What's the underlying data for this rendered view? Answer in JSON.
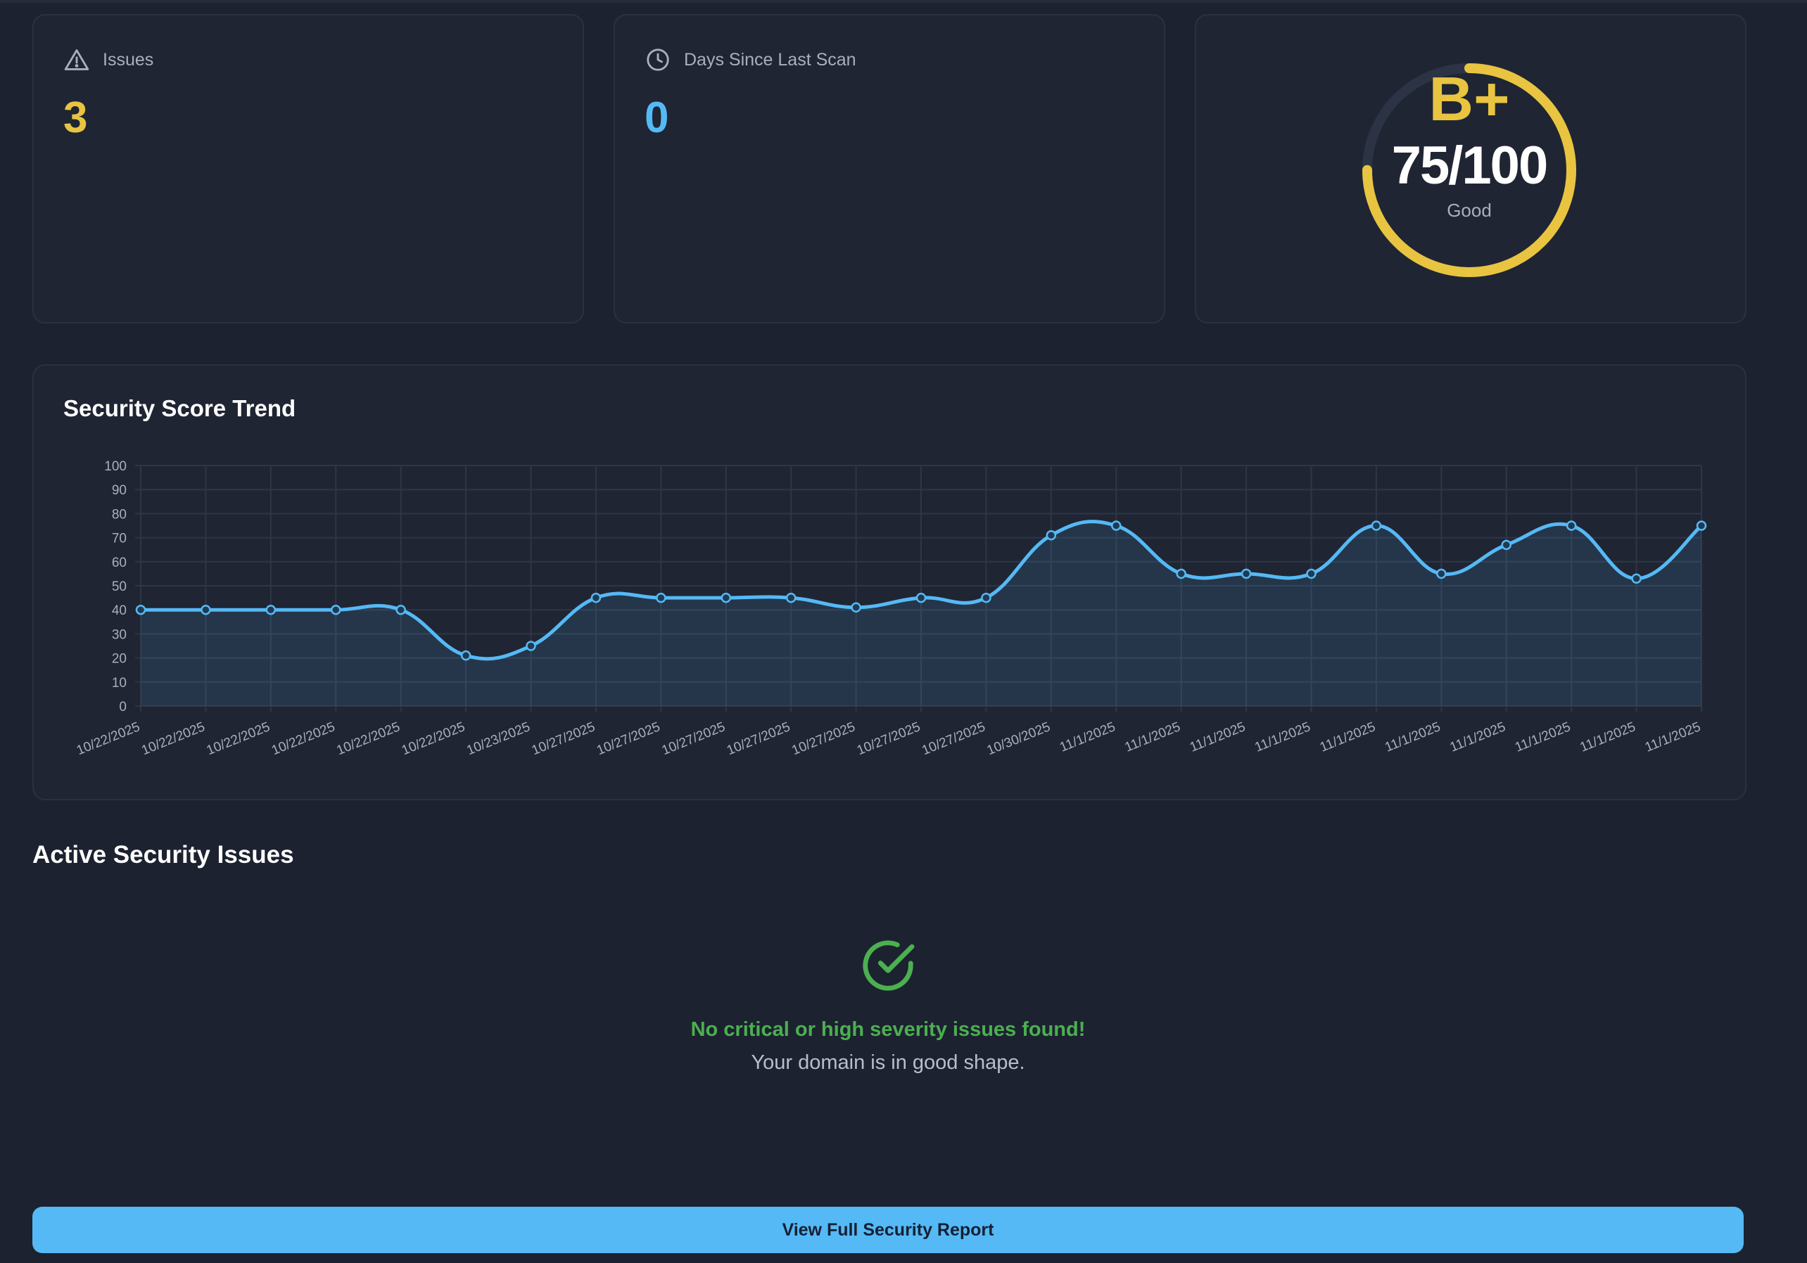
{
  "stats": {
    "issues": {
      "label": "Issues",
      "value": "3",
      "icon": "warning-triangle-icon",
      "color": "#e8c441"
    },
    "days_since_scan": {
      "label": "Days Since Last Scan",
      "value": "0",
      "icon": "clock-icon",
      "color": "#55b9f5"
    }
  },
  "score_card": {
    "grade": "B+",
    "score_text": "75/100",
    "status": "Good",
    "score": 75,
    "max": 100,
    "accent": "#e8c441"
  },
  "chart": {
    "title": "Security Score Trend"
  },
  "chart_data": {
    "type": "line",
    "title": "Security Score Trend",
    "xlabel": "",
    "ylabel": "",
    "ylim": [
      0,
      100
    ],
    "yticks": [
      0,
      10,
      20,
      30,
      40,
      50,
      60,
      70,
      80,
      90,
      100
    ],
    "grid": true,
    "fill": true,
    "color": "#55b9f5",
    "categories": [
      "10/22/2025",
      "10/22/2025",
      "10/22/2025",
      "10/22/2025",
      "10/22/2025",
      "10/22/2025",
      "10/23/2025",
      "10/27/2025",
      "10/27/2025",
      "10/27/2025",
      "10/27/2025",
      "10/27/2025",
      "10/27/2025",
      "10/27/2025",
      "10/30/2025",
      "11/1/2025",
      "11/1/2025",
      "11/1/2025",
      "11/1/2025",
      "11/1/2025",
      "11/1/2025",
      "11/1/2025",
      "11/1/2025",
      "11/1/2025",
      "11/1/2025"
    ],
    "values": [
      40,
      40,
      40,
      40,
      40,
      21,
      25,
      45,
      45,
      45,
      45,
      41,
      45,
      45,
      71,
      75,
      55,
      55,
      55,
      75,
      55,
      67,
      75,
      53,
      75
    ]
  },
  "issues_section": {
    "title": "Active Security Issues",
    "empty_title": "No critical or high severity issues found!",
    "empty_subtitle": "Your domain is in good shape.",
    "icon": "check-circle-icon",
    "success_color": "#4caf50"
  },
  "actions": {
    "report_button": "View Full Security Report"
  }
}
